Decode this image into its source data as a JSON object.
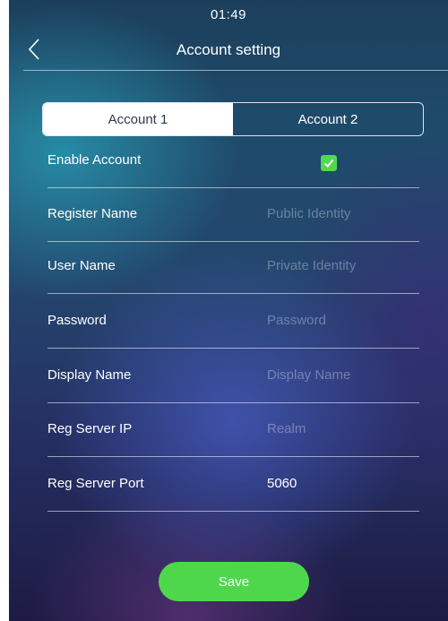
{
  "status_bar": {
    "time": "01:49"
  },
  "header": {
    "title": "Account setting",
    "back_icon": "chevron-left-icon"
  },
  "tabs": [
    {
      "label": "Account 1",
      "active": true
    },
    {
      "label": "Account 2",
      "active": false
    }
  ],
  "form": {
    "enable_account": {
      "label": "Enable Account",
      "checked": true,
      "check_color": "#4fd94f"
    },
    "register_name": {
      "label": "Register Name",
      "value": "",
      "placeholder": "Public Identity"
    },
    "user_name": {
      "label": "User Name",
      "value": "",
      "placeholder": "Private Identity"
    },
    "password": {
      "label": "Password",
      "value": "",
      "placeholder": "Password"
    },
    "display_name": {
      "label": "Display Name",
      "value": "",
      "placeholder": "Display Name"
    },
    "reg_server_ip": {
      "label": "Reg Server IP",
      "value": "",
      "placeholder": "Realm"
    },
    "reg_server_port": {
      "label": "Reg Server Port",
      "value": "5060",
      "placeholder": ""
    }
  },
  "save_button": {
    "label": "Save",
    "color": "#4fd74c"
  }
}
